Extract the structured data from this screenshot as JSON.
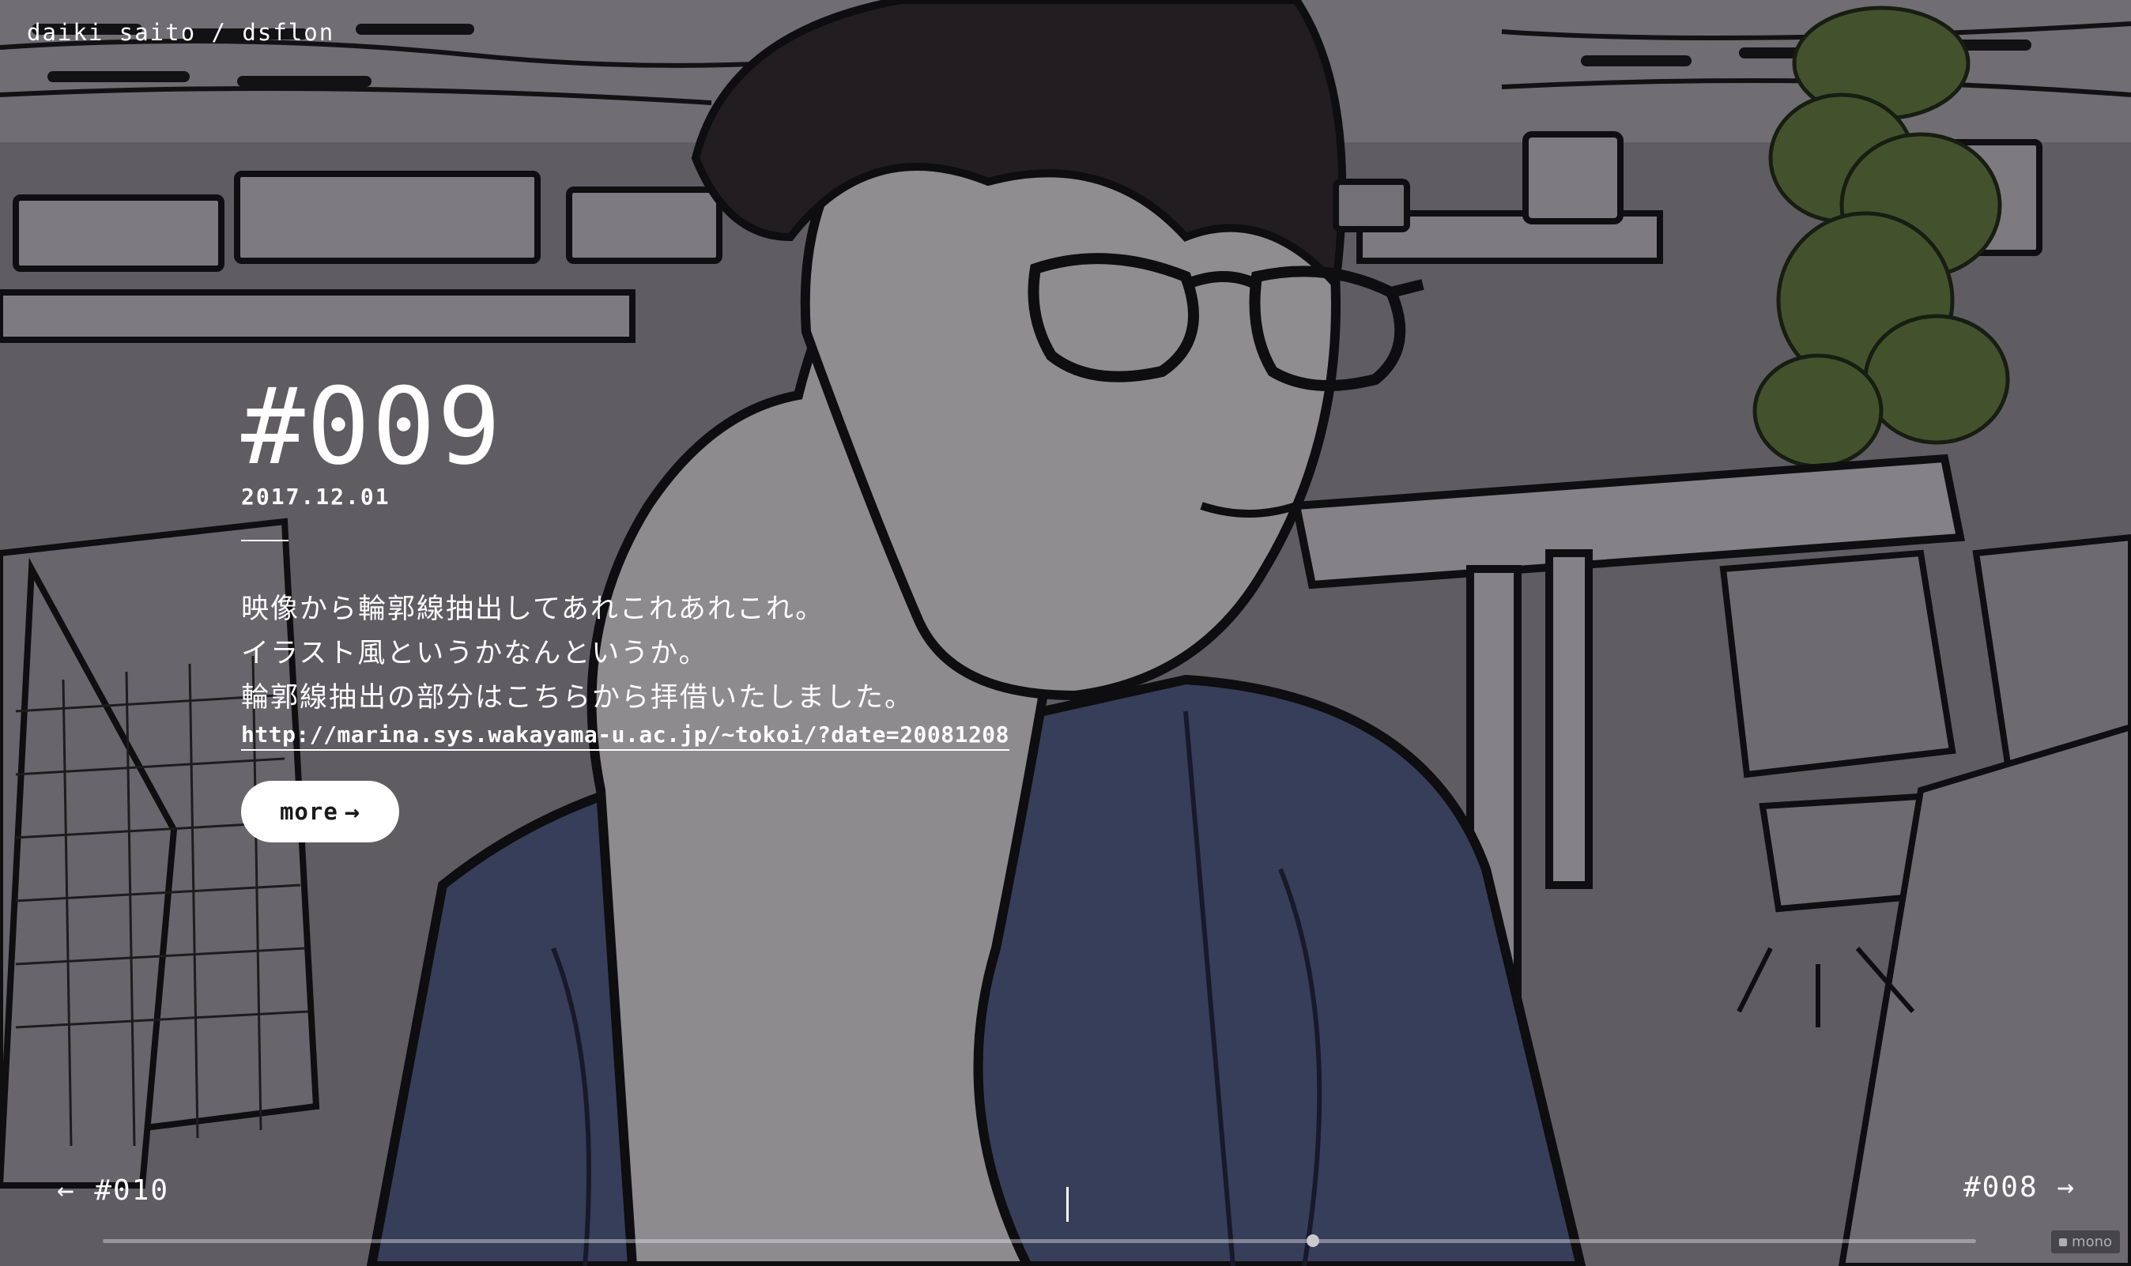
{
  "site": {
    "title": "daiki saito / dsflon"
  },
  "entry": {
    "number": "#009",
    "date": "2017.12.01",
    "description": [
      "映像から輪郭線抽出してあれこれあれこれ。",
      "イラスト風というかなんというか。",
      "輪郭線抽出の部分はこちらから拝借いたしました。"
    ],
    "link_text": "http://marina.sys.wakayama-u.ac.jp/~tokoi/?date=20081208",
    "more_label": "more",
    "more_arrow": "→"
  },
  "nav": {
    "prev_label": "← #010",
    "next_label": "#008 →"
  },
  "video": {
    "progress_percent": 64.6
  },
  "watermark": {
    "label": "mono"
  },
  "icons": {
    "more_arrow": "right-arrow-icon",
    "prev_arrow": "left-arrow-icon",
    "next_arrow": "right-arrow-icon"
  }
}
